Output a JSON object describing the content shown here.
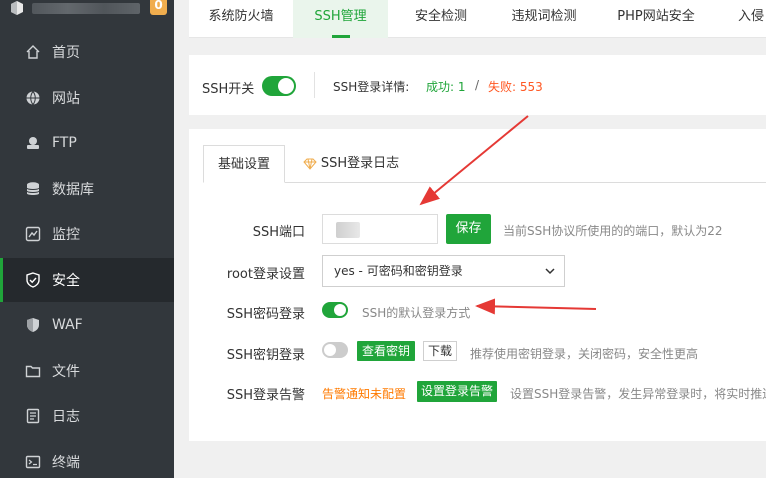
{
  "sidebar": {
    "badge": "0",
    "items": [
      {
        "label": "首页",
        "icon": "home-icon"
      },
      {
        "label": "网站",
        "icon": "globe-icon"
      },
      {
        "label": "FTP",
        "icon": "ftp-icon"
      },
      {
        "label": "数据库",
        "icon": "database-icon"
      },
      {
        "label": "监控",
        "icon": "monitor-icon"
      },
      {
        "label": "安全",
        "icon": "shield-check-icon",
        "active": true
      },
      {
        "label": "WAF",
        "icon": "shield-icon"
      },
      {
        "label": "文件",
        "icon": "folder-icon"
      },
      {
        "label": "日志",
        "icon": "log-icon"
      },
      {
        "label": "终端",
        "icon": "terminal-icon"
      }
    ]
  },
  "tabs": [
    {
      "label": "系统防火墙"
    },
    {
      "label": "SSH管理",
      "active": true
    },
    {
      "label": "安全检测"
    },
    {
      "label": "违规词检测"
    },
    {
      "label": "PHP网站安全"
    },
    {
      "label": "入侵"
    }
  ],
  "ssh_status": {
    "switch_label": "SSH开关",
    "switch_on": true,
    "detail_label": "SSH登录详情:",
    "success_text": "成功: 1",
    "separator": "/",
    "fail_text": "失败: 553"
  },
  "subtabs": [
    {
      "label": "基础设置",
      "active": true
    },
    {
      "label": "SSH登录日志",
      "icon": "diamond-icon"
    }
  ],
  "form": {
    "port_label": "SSH端口",
    "save_label": "保存",
    "port_hint": "当前SSH协议所使用的的端口，默认为22",
    "root_label": "root登录设置",
    "root_value": "yes - 可密码和密钥登录",
    "password_label": "SSH密码登录",
    "password_on": true,
    "password_hint": "SSH的默认登录方式",
    "key_label": "SSH密钥登录",
    "key_on": false,
    "view_key_label": "查看密钥",
    "download_label": "下载",
    "key_hint": "推荐使用密钥登录，关闭密码，安全性更高",
    "alert_label": "SSH登录告警",
    "alert_status": "告警通知未配置",
    "alert_button": "设置登录告警",
    "alert_hint": "设置SSH登录告警，发生异常登录时，将实时推送"
  },
  "colors": {
    "accent": "#20a53a",
    "sidebar_bg": "#32373c",
    "success": "#20a53a",
    "fail": "#ff5722",
    "warn": "#ff7a00",
    "arrow": "#e53935"
  }
}
